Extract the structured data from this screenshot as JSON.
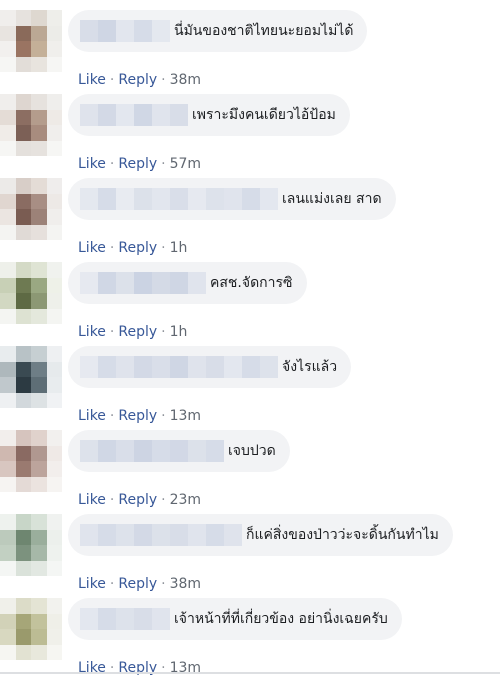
{
  "comments": [
    {
      "text": "นี่มันของชาติไทยนะยอมไม่ได้",
      "like": "Like",
      "reply": "Reply",
      "time": "38m",
      "avatar": [
        "#f0eeec",
        "#e6e2de",
        "#ded8d0",
        "#eeeeea",
        "#e8e4e0",
        "#8a6a5a",
        "#bba894",
        "#ecece8",
        "#f2f0ee",
        "#9a7462",
        "#c4b098",
        "#f0efec",
        "#f6f6f4",
        "#e2ddd8",
        "#e8e4de",
        "#f6f6f4"
      ],
      "name_blur": [
        "#d8dde8",
        "#cfd6e4",
        "#e2e6ee",
        "#d6dce8",
        "#e4e8ef"
      ]
    },
    {
      "text": "เพราะมึงคนเดียวไอ้ป้อม",
      "like": "Like",
      "reply": "Reply",
      "time": "57m",
      "avatar": [
        "#f0eeec",
        "#ded6d0",
        "#e6e2de",
        "#efeeec",
        "#e4dcd6",
        "#8c6e62",
        "#b49c8c",
        "#eeeae6",
        "#f0ece8",
        "#7c6056",
        "#a88c7e",
        "#f0eeec",
        "#f6f6f4",
        "#e4e0dc",
        "#e6e2de",
        "#f6f6f4"
      ],
      "name_blur": [
        "#dfe3ec",
        "#d3d9e6",
        "#e3e7ef",
        "#d0d7e5",
        "#e0e4ed",
        "#d8dde8"
      ]
    },
    {
      "text": "เลนแม่งเลย สาด",
      "like": "Like",
      "reply": "Reply",
      "time": "1h",
      "avatar": [
        "#eceae8",
        "#d8cec8",
        "#e4dcd6",
        "#efedec",
        "#e0d6d0",
        "#8a6c62",
        "#a88e84",
        "#ede9e6",
        "#ebe5e1",
        "#7a5c52",
        "#9c8278",
        "#f0eeec",
        "#f4f4f2",
        "#e0dad6",
        "#e6e0dc",
        "#f4f4f2"
      ],
      "name_blur": [
        "#e4e8ef",
        "#d6dce8",
        "#e8ebf1",
        "#dce1ea",
        "#e2e6ee",
        "#d9dee9",
        "#e6e9f0",
        "#dde2eb",
        "#e0e4ed",
        "#d6dce8",
        "#e3e7ef"
      ]
    },
    {
      "text": "คสช.จัดการซิ",
      "like": "Like",
      "reply": "Reply",
      "time": "1h",
      "avatar": [
        "#eef0ea",
        "#d4dac6",
        "#dfe4d4",
        "#f0f2ee",
        "#c8d0b6",
        "#6e7a52",
        "#9aa882",
        "#eef1e8",
        "#d2d8c2",
        "#5e6a44",
        "#8c9874",
        "#eef0ea",
        "#f4f5f2",
        "#dde2d2",
        "#e4e8dc",
        "#f4f5f2"
      ],
      "name_blur": [
        "#e6e9f0",
        "#d0d7e5",
        "#dce1ea",
        "#cbd3e3",
        "#d4dae6",
        "#cfd6e4",
        "#e0e4ed"
      ]
    },
    {
      "text": "จังไรแล้ว",
      "like": "Like",
      "reply": "Reply",
      "time": "13m",
      "avatar": [
        "#e8ecee",
        "#b8c2c6",
        "#c6cfd2",
        "#eef0f2",
        "#aeb8bc",
        "#3a4a52",
        "#6e7e86",
        "#e6eaec",
        "#c0c8cc",
        "#2c3a42",
        "#5e6e76",
        "#e8ecee",
        "#eef0f2",
        "#d2d8dc",
        "#dde2e4",
        "#f0f2f4"
      ],
      "name_blur": [
        "#e6e9f0",
        "#d6dce8",
        "#dfe3ec",
        "#d3d9e6",
        "#d9dee9",
        "#cfd6e4",
        "#dfe3ec",
        "#d8dde8",
        "#e3e7ef",
        "#d6dce8",
        "#dde2eb"
      ]
    },
    {
      "text": "เจบปวด",
      "like": "Like",
      "reply": "Reply",
      "time": "23m",
      "avatar": [
        "#f2eeec",
        "#d6c4be",
        "#e0d2cc",
        "#f2f0ee",
        "#cfb8b0",
        "#8a6a62",
        "#b09890",
        "#efe9e6",
        "#d8c6c0",
        "#9a7a70",
        "#bca49c",
        "#f2eeec",
        "#f6f4f2",
        "#e4dad6",
        "#ebe3df",
        "#f6f4f2"
      ],
      "name_blur": [
        "#dde2eb",
        "#d0d7e5",
        "#d9dee9",
        "#cdd4e3",
        "#d6dce8",
        "#d2d8e6",
        "#dce1ea",
        "#d6dce8"
      ]
    },
    {
      "text": "ก็แค่สิ่งของป่าวว่ะจะดิ้นกันทำไม",
      "like": "Like",
      "reply": "Reply",
      "time": "38m",
      "avatar": [
        "#eef2ee",
        "#c8d6c8",
        "#d8e2d8",
        "#f0f2f0",
        "#bccabc",
        "#6e8670",
        "#9aae9c",
        "#ecf0ec",
        "#c2d0c2",
        "#7c927e",
        "#a6b8a8",
        "#eef2ee",
        "#f4f6f4",
        "#dae2da",
        "#e2e8e2",
        "#f4f6f4"
      ],
      "name_blur": [
        "#e0e4ed",
        "#d6dce8",
        "#dde2eb",
        "#d3d9e6",
        "#dce1ea",
        "#d8dde8",
        "#e0e4ed",
        "#d6dce8",
        "#dfe3ec"
      ]
    },
    {
      "text": "เจ้าหน้าที่ที่เกี่ยวข้อง อย่านิ่งเฉยครับ",
      "like": "Like",
      "reply": "Reply",
      "time": "13m",
      "avatar": [
        "#f0f0ea",
        "#dcdcc8",
        "#e4e4d4",
        "#f2f2ee",
        "#d2d2b8",
        "#a6a678",
        "#c2c29c",
        "#efefe8",
        "#d8d8c0",
        "#9a9a6c",
        "#bcbc94",
        "#f0f0ea",
        "#f6f6f2",
        "#e2e2d2",
        "#e8e8dc",
        "#f6f6f2"
      ],
      "name_blur": [
        "#e3e7ef",
        "#d6dce8",
        "#dde2eb",
        "#d8dde8",
        "#e0e4ed"
      ]
    }
  ]
}
